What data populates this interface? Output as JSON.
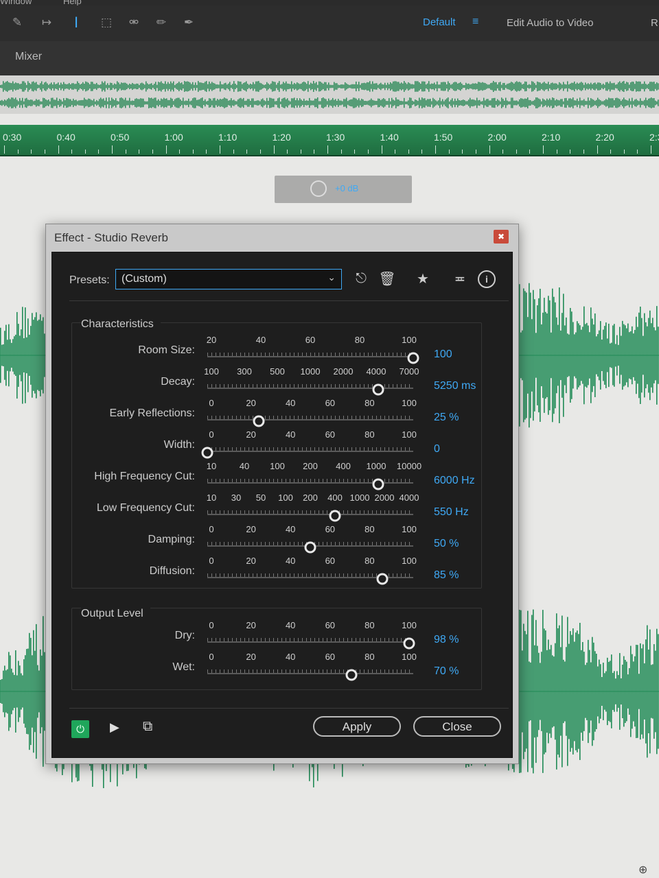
{
  "menubar": {
    "items": [
      "Window",
      "Help"
    ]
  },
  "toolbar": {
    "workspace": "Default",
    "edit_audio_to_video": "Edit Audio to Video",
    "extra": "R"
  },
  "panel": {
    "mixer_tab": "Mixer"
  },
  "timeline": {
    "labels": [
      "0:30",
      "0:40",
      "0:50",
      "1:00",
      "1:10",
      "1:20",
      "1:30",
      "1:40",
      "1:50",
      "2:00",
      "2:10",
      "2:20",
      "2:3"
    ]
  },
  "hud": {
    "value": "+0 dB"
  },
  "dialog": {
    "title": "Effect - Studio Reverb",
    "presets_label": "Presets:",
    "preset_value": "(Custom)",
    "characteristics_label": "Characteristics",
    "output_level_label": "Output Level",
    "apply_label": "Apply",
    "close_label": "Close"
  },
  "params": [
    {
      "label": "Room Size:",
      "scale": [
        "20",
        "40",
        "60",
        "80",
        "100"
      ],
      "value": "100",
      "fraction": 1.0
    },
    {
      "label": "Decay:",
      "scale": [
        "100",
        "300",
        "500",
        "1000",
        "2000",
        "4000",
        "7000"
      ],
      "value": "5250 ms",
      "fraction": 0.83
    },
    {
      "label": "Early Reflections:",
      "scale": [
        "0",
        "20",
        "40",
        "60",
        "80",
        "100"
      ],
      "value": "25 %",
      "fraction": 0.25
    },
    {
      "label": "Width:",
      "scale": [
        "0",
        "20",
        "40",
        "60",
        "80",
        "100"
      ],
      "value": "0",
      "fraction": 0.0
    },
    {
      "label": "High Frequency Cut:",
      "scale": [
        "10",
        "40",
        "100",
        "200",
        "400",
        "1000",
        "10000"
      ],
      "value": "6000 Hz",
      "fraction": 0.83
    },
    {
      "label": "Low Frequency Cut:",
      "scale": [
        "10",
        "30",
        "50",
        "100",
        "200",
        "400",
        "1000",
        "2000",
        "4000"
      ],
      "value": "550 Hz",
      "fraction": 0.62
    },
    {
      "label": "Damping:",
      "scale": [
        "0",
        "20",
        "40",
        "60",
        "80",
        "100"
      ],
      "value": "50 %",
      "fraction": 0.5
    },
    {
      "label": "Diffusion:",
      "scale": [
        "0",
        "20",
        "40",
        "60",
        "80",
        "100"
      ],
      "value": "85 %",
      "fraction": 0.85
    },
    {
      "label": "Dry:",
      "scale": [
        "0",
        "20",
        "40",
        "60",
        "80",
        "100"
      ],
      "value": "98 %",
      "fraction": 0.98
    },
    {
      "label": "Wet:",
      "scale": [
        "0",
        "20",
        "40",
        "60",
        "80",
        "100"
      ],
      "value": "70 %",
      "fraction": 0.7
    }
  ],
  "colors": {
    "accent": "#3fa9f5",
    "waveform": "#1f8a55",
    "power_on": "#1fa65b"
  },
  "icons": [
    "move-icon",
    "time-selection-icon",
    "text-cursor-icon",
    "marquee-icon",
    "lasso-icon",
    "brush-icon",
    "spot-healing-icon",
    "save-preset-icon",
    "delete-preset-icon",
    "favorite-icon",
    "routing-icon",
    "info-icon",
    "power-icon",
    "play-icon",
    "export-icon"
  ]
}
